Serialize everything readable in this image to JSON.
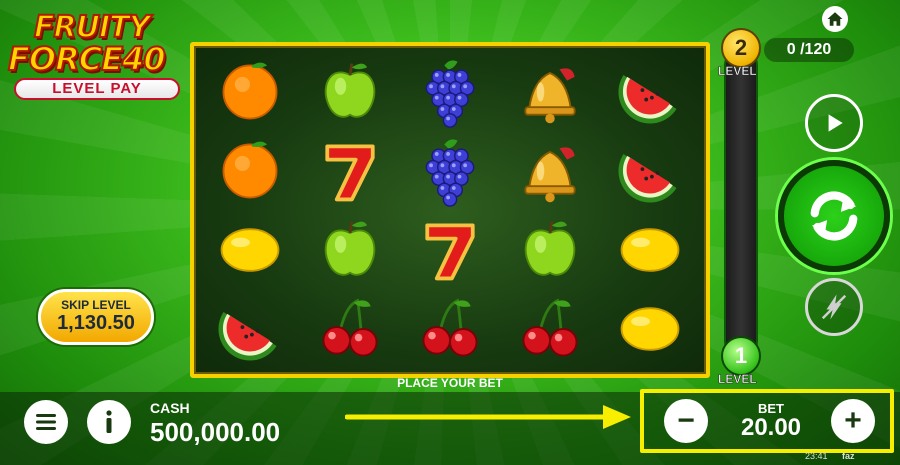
{
  "logo": {
    "line1": "FRUITY",
    "line2": "FORCE40",
    "badge": "LEVEL PAY"
  },
  "reels": {
    "grid": [
      [
        "orange",
        "apple",
        "grapes",
        "bell",
        "watermelon"
      ],
      [
        "orange",
        "seven",
        "grapes",
        "bell",
        "watermelon"
      ],
      [
        "lemon",
        "apple",
        "seven",
        "apple",
        "lemon"
      ],
      [
        "watermelon",
        "cherry",
        "cherry",
        "cherry",
        "lemon"
      ]
    ],
    "status_text": "PLACE YOUR BET"
  },
  "level_meter": {
    "top_level": "2",
    "top_label": "LEVEL",
    "bottom_level": "1",
    "bottom_label": "LEVEL",
    "progress_current": "0",
    "progress_total": "/120"
  },
  "skip_level": {
    "label": "SKIP LEVEL",
    "value": "1,130.50"
  },
  "cash": {
    "label": "CASH",
    "value": "500,000.00"
  },
  "bet": {
    "label": "BET",
    "value": "20.00",
    "minus": "−",
    "plus": "+"
  },
  "footer": {
    "clock": "23:41",
    "brand": "faz"
  },
  "icons": {
    "home": "home-icon",
    "play": "play-icon",
    "spin": "spin-icon",
    "turbo": "turbo-icon",
    "menu": "menu-icon",
    "info": "info-icon"
  },
  "colors": {
    "accent_yellow": "#f5d100",
    "spin_green": "#17a90b",
    "frame_highlight": "#f7ee00"
  }
}
